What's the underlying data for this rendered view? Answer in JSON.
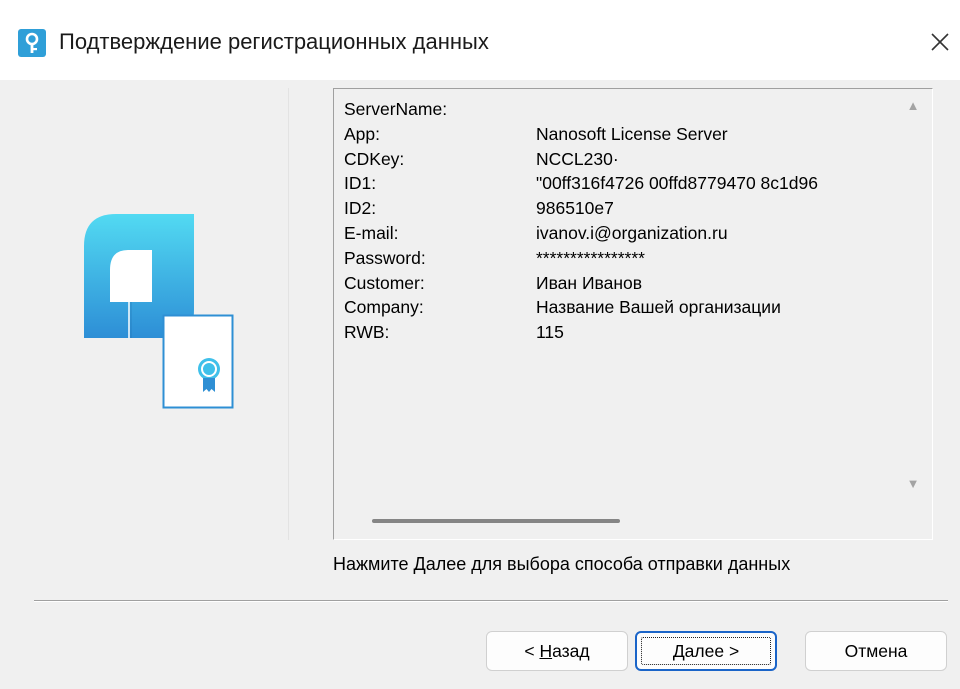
{
  "window": {
    "title": "Подтверждение регистрационных данных",
    "icon": "registration-key-icon",
    "close_icon": "close-icon"
  },
  "registration": {
    "rows": [
      {
        "key": "ServerName:",
        "value": ""
      },
      {
        "key": "App:",
        "value": "Nanosoft License Server"
      },
      {
        "key": "CDKey:",
        "value": "NCCL230·"
      },
      {
        "key": "ID1:",
        "value": "\"00ff316f4726 00ffd8779470 8c1d96"
      },
      {
        "key": "ID2:",
        "value": "986510e7"
      },
      {
        "key": "E-mail:",
        "value": "ivanov.i@organization.ru"
      },
      {
        "key": "Password:",
        "value": "****************"
      },
      {
        "key": "Customer:",
        "value": "Иван Иванов"
      },
      {
        "key": "Company:",
        "value": "Название Вашей организации"
      },
      {
        "key": "RWB:",
        "value": "115"
      }
    ]
  },
  "hint": "Нажмите Далее для выбора способа отправки данных",
  "buttons": {
    "back_prefix": "< ",
    "back_mnemonic": "Н",
    "back_rest": "азад",
    "next_mnemonic": "Д",
    "next_rest": "алее >",
    "cancel": "Отмена"
  },
  "colors": {
    "logo_gradient_top": "#4fd6ef",
    "logo_gradient_bottom": "#2f8fd6",
    "accent": "#1a64c8",
    "face": "#f0f0f0"
  }
}
